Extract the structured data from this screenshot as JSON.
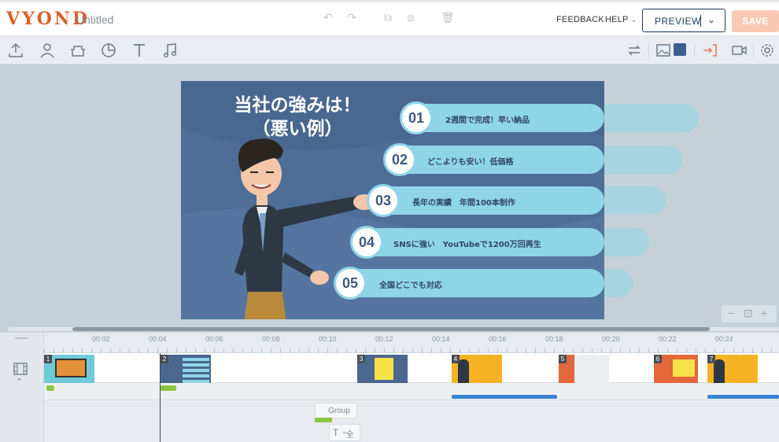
{
  "app": {
    "logo": "VYOND",
    "doc_title": "Untitled"
  },
  "header": {
    "feedback_label": "FEEDBACK",
    "help_label": "HELP",
    "preview_label": "PREVIEW",
    "save_label": "SAVE"
  },
  "slide": {
    "title_line1": "当社の強みは！",
    "title_line2": "（悪い例）",
    "items": [
      {
        "num": "01",
        "text": "2週間で完成！早い納品"
      },
      {
        "num": "02",
        "text": "どこよりも安い！低価格"
      },
      {
        "num": "03",
        "text": "長年の実績　年間100本制作"
      },
      {
        "num": "04",
        "text": "SNSに強い　YouTubeで1200万回再生"
      },
      {
        "num": "05",
        "text": "全国どこでも対応"
      }
    ]
  },
  "timeline": {
    "ticks": [
      "00:02",
      "00:04",
      "00:06",
      "00:08",
      "00:10",
      "00:12",
      "00:14",
      "00:16",
      "00:18",
      "00:20",
      "00:22",
      "00:24"
    ],
    "scenes": [
      "1",
      "2",
      "3",
      "4",
      "5",
      "6",
      "7"
    ],
    "group_label": "Group",
    "text_layer_label": "\"全国"
  },
  "colors": {
    "brand": "#d9622b",
    "preview": "#1f3a5c",
    "save_disabled": "#f9c9b5",
    "slide_bg": "#4a6790",
    "bar": "#8fd5e8"
  }
}
